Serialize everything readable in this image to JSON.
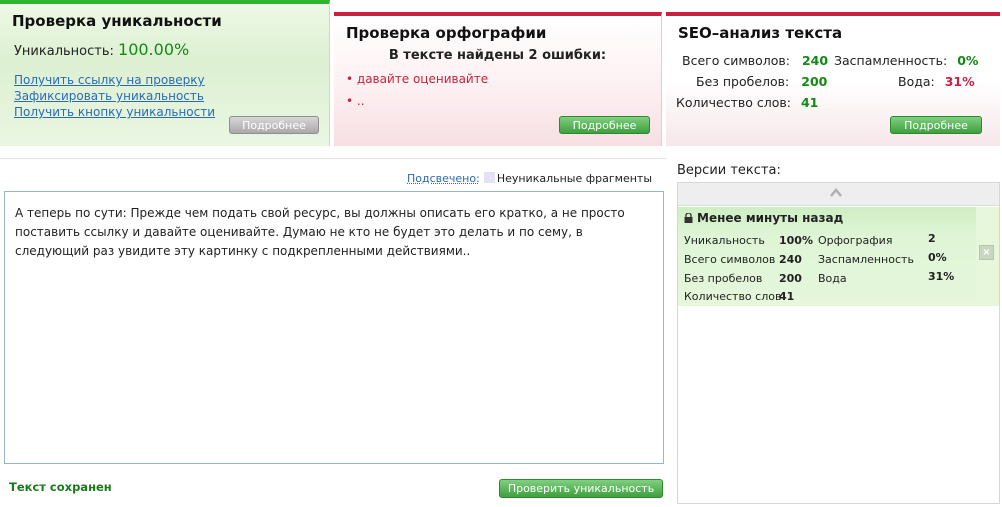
{
  "uniqueness_panel": {
    "title": "Проверка уникальности",
    "label": "Уникальность:",
    "value": "100.00%",
    "links": [
      "Получить ссылку на проверку",
      "Зафиксировать уникальность",
      "Получить кнопку уникальности"
    ],
    "more_button": "Подробнее"
  },
  "spelling_panel": {
    "title": "Проверка орфографии",
    "errors_heading": "В тексте найдены 2 ошибки:",
    "errors": [
      "• давайте оценивайте",
      "• .."
    ],
    "more_button": "Подробнее"
  },
  "seo_panel": {
    "title": "SEO–анализ текста",
    "total_chars_label": "Всего символов:",
    "total_chars_value": "240",
    "no_spaces_label": "Без пробелов:",
    "no_spaces_value": "200",
    "words_label": "Количество слов:",
    "words_value": "41",
    "spam_label": "Заспамленность:",
    "spam_value": "0%",
    "water_label": "Вода:",
    "water_value": "31%",
    "more_button": "Подробнее"
  },
  "highlight": {
    "label": "Подсвечено:",
    "legend": "Неуникальные фрагменты"
  },
  "editor": {
    "text": "А теперь по сути: Прежде чем подать свой ресурс, вы должны описать его кратко, а не просто поставить ссылку и давайте оценивайте. Думаю не кто не будет это делать и по сему, в следующий раз увидите эту картинку с подкрепленными действиями.."
  },
  "status": {
    "saved_text": "Текст сохранен",
    "check_button": "Проверить уникальность"
  },
  "versions": {
    "title": "Версии текста:",
    "entry": {
      "time": "Менее минуты назад",
      "uniq_label": "Уникальность",
      "uniq_value": "100%",
      "spelling_label": "Орфография",
      "spelling_value": "2",
      "chars_label": "Всего символов",
      "chars_value": "240",
      "spam_label": "Заспамленность",
      "spam_value": "0%",
      "nospace_label": "Без пробелов",
      "nospace_value": "200",
      "water_label": "Вода",
      "water_value": "31%",
      "words_label": "Количество слов",
      "words_value": "41"
    }
  },
  "colors": {
    "accent_green": "#2db52d",
    "accent_red": "#c9213f",
    "link_blue": "#2a6bb4"
  }
}
